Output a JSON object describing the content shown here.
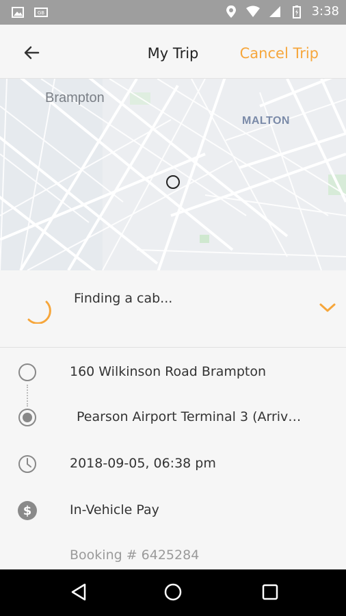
{
  "status_bar": {
    "time": "3:38",
    "icons": [
      "image-icon",
      "keyboard-icon",
      "location-icon",
      "wifi-icon",
      "battery-icon"
    ]
  },
  "header": {
    "title": "My Trip",
    "cancel_label": "Cancel Trip",
    "back_icon": "arrow-left-icon"
  },
  "map": {
    "labels": [
      "Brampton",
      "MALTON"
    ]
  },
  "status": {
    "text": "Finding a cab...",
    "spinner_icon": "loading-spinner-icon",
    "expand_icon": "chevron-down-icon"
  },
  "trip": {
    "pickup": "160 Wilkinson Road Brampton",
    "dropoff": "Pearson Airport Terminal 3 (Arriv…",
    "datetime": "2018-09-05, 06:38 pm",
    "payment": "In-Vehicle Pay",
    "booking": "Booking # 6425284"
  },
  "nav_bar": {
    "icons": [
      "back-triangle-icon",
      "home-circle-icon",
      "recents-square-icon"
    ]
  },
  "colors": {
    "accent": "#f6a63b",
    "status_bar": "#9e9e9e",
    "background": "#f6f6f6"
  }
}
